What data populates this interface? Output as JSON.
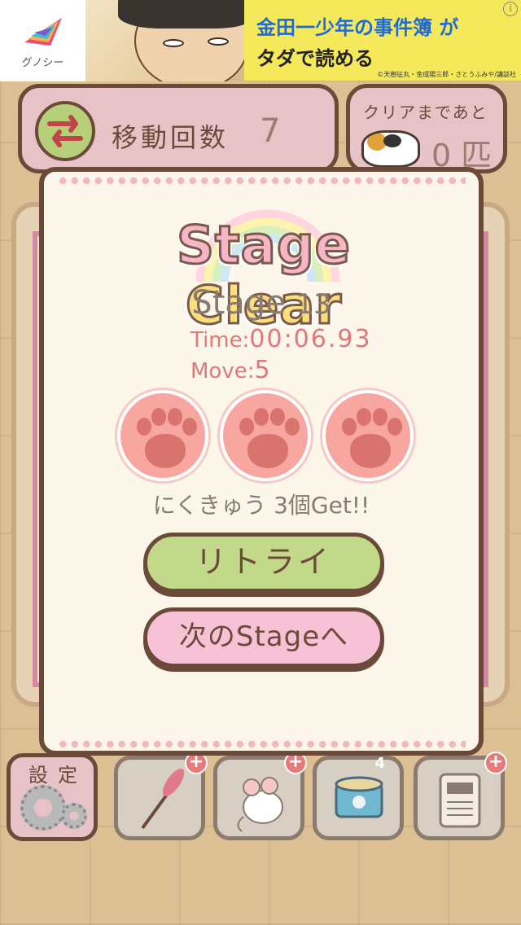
{
  "ad": {
    "brand": "グノシー",
    "headline_line1": "金田一少年の事件簿 が",
    "headline_line2": "タダで読める",
    "copyright": "©天樹征丸・金成陽三郎・さとうふみや/講談社",
    "info_icon": "i"
  },
  "hud": {
    "moves_label": "移動回数",
    "moves_value": "7",
    "clear_label": "クリアまであと",
    "clear_value": "0 匹"
  },
  "toolbar": {
    "settings_label": "設定",
    "tools": [
      {
        "icon": "brush-icon",
        "plus": "+"
      },
      {
        "icon": "mouse-toy-icon",
        "plus": "+"
      },
      {
        "icon": "cat-food-can-icon",
        "count": "4"
      },
      {
        "icon": "heater-icon",
        "plus": "+"
      }
    ]
  },
  "dialog": {
    "title_part1": "Stage ",
    "title_part2": "Clear",
    "stage_label": "Stage",
    "stage_number": "13",
    "time_label": "Time:",
    "time_value": "00:06.93",
    "move_label": "Move:",
    "move_value": "5",
    "paws_earned": 3,
    "nikukyu_text": "にくきゅう 3個Get!!",
    "retry_button": "リトライ",
    "next_button": "次のStageへ"
  },
  "colors": {
    "panel_border": "#6b4a3a",
    "panel_pink": "#e7c2c6",
    "retry_green": "#c3d98a",
    "next_pink": "#f7c2d6",
    "paw_pink": "#f7a6a0",
    "time_red": "#e07878"
  }
}
